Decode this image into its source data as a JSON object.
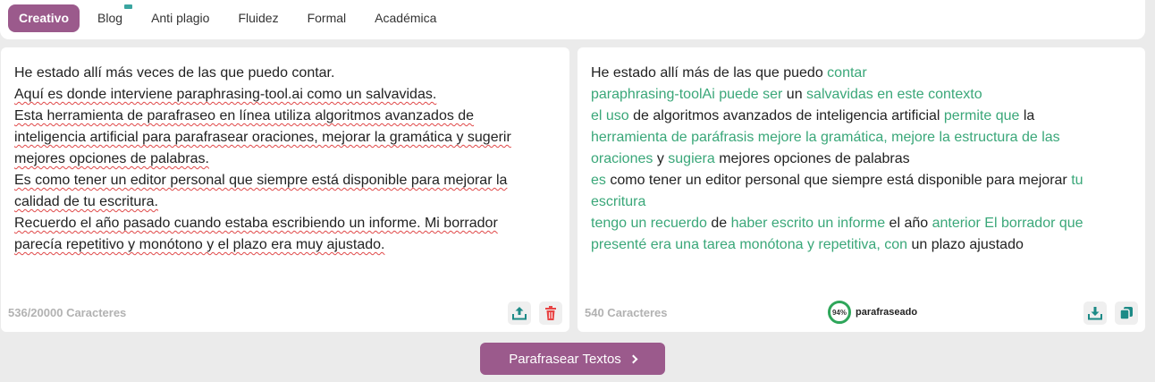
{
  "modes": [
    "Creativo",
    "Blog",
    "Anti plagio",
    "Fluidez",
    "Formal",
    "Académica"
  ],
  "active_mode": "Creativo",
  "input": {
    "lines": [
      "He estado allí más veces de las que puedo contar.",
      "Aquí es donde interviene paraphrasing-tool.ai como un salvavidas.",
      "Esta herramienta de parafraseo en línea utiliza algoritmos avanzados de",
      "inteligencia artificial para parafrasear oraciones, mejorar la gramática y sugerir",
      "mejores opciones de palabras.",
      "Es como tener un editor personal que siempre está disponible para mejorar la",
      "calidad de tu escritura.",
      "Recuerdo el año pasado cuando estaba escribiendo un informe. Mi borrador",
      "parecía repetitivo y monótono y el plazo era muy ajustado."
    ],
    "char_count": "536/20000 Caracteres"
  },
  "output": {
    "lines": [
      [
        {
          "t": "He estado allí más de las que puedo ",
          "c": false
        },
        {
          "t": "contar",
          "c": true
        }
      ],
      [
        {
          "t": "paraphrasing-toolAi puede ser",
          "c": true
        },
        {
          "t": " un ",
          "c": false
        },
        {
          "t": "salvavidas en este contexto",
          "c": true
        }
      ],
      [
        {
          "t": "el uso",
          "c": true
        },
        {
          "t": " de algoritmos avanzados de inteligencia artificial ",
          "c": false
        },
        {
          "t": "permite que",
          "c": true
        },
        {
          "t": " la",
          "c": false
        }
      ],
      [
        {
          "t": "herramienta de paráfrasis mejore la gramática, mejore la estructura de las",
          "c": true
        }
      ],
      [
        {
          "t": "oraciones",
          "c": true
        },
        {
          "t": " y ",
          "c": false
        },
        {
          "t": "sugiera",
          "c": true
        },
        {
          "t": " mejores opciones de palabras",
          "c": false
        }
      ],
      [
        {
          "t": "es",
          "c": true
        },
        {
          "t": " como tener un editor personal que siempre está disponible para mejorar ",
          "c": false
        },
        {
          "t": "tu",
          "c": true
        }
      ],
      [
        {
          "t": "escritura",
          "c": true
        }
      ],
      [
        {
          "t": "tengo un recuerdo",
          "c": true
        },
        {
          "t": " de ",
          "c": false
        },
        {
          "t": "haber escrito un informe",
          "c": true
        },
        {
          "t": " el año ",
          "c": false
        },
        {
          "t": "anterior El borrador que",
          "c": true
        }
      ],
      [
        {
          "t": "presenté era una tarea monótona y repetitiva, con",
          "c": true
        },
        {
          "t": " un plazo ajustado",
          "c": false
        }
      ]
    ],
    "char_count": "540 Caracteres",
    "score": "94%",
    "score_label": "parafraseado"
  },
  "submit_label": "Parafrasear Textos",
  "colors": {
    "accent": "#9b5a8c",
    "changed_text": "#3aa779",
    "icon_teal": "#1c8a86",
    "delete_red": "#e84545",
    "score_ring": "#2ea65a"
  },
  "icons": {
    "upload": "upload-icon",
    "delete": "trash-icon",
    "download": "download-icon",
    "copy": "copy-icon",
    "submit": "chevron-right-icon",
    "premium": "crown-icon"
  }
}
